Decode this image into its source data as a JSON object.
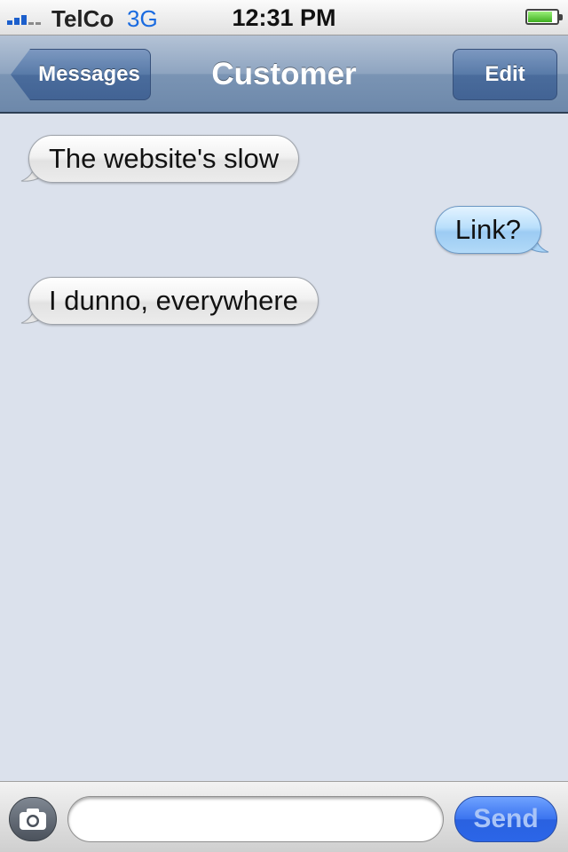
{
  "status_bar": {
    "carrier": "TelCo",
    "network": "3G",
    "time": "12:31 PM",
    "battery_level": 0.8
  },
  "nav": {
    "back_label": "Messages",
    "title": "Customer",
    "edit_label": "Edit"
  },
  "messages": [
    {
      "direction": "incoming",
      "text": "The website's slow"
    },
    {
      "direction": "outgoing",
      "text": "Link?"
    },
    {
      "direction": "incoming",
      "text": "I dunno, everywhere"
    }
  ],
  "composer": {
    "input_value": "",
    "send_label": "Send"
  },
  "colors": {
    "background": "#dbe1ec",
    "incoming_bubble": "#eeeeee",
    "outgoing_bubble": "#b9dffb",
    "send_button": "#3a73ef"
  },
  "icons": {
    "camera": "camera-icon",
    "signal": "signal-strength-icon",
    "battery": "battery-icon"
  }
}
